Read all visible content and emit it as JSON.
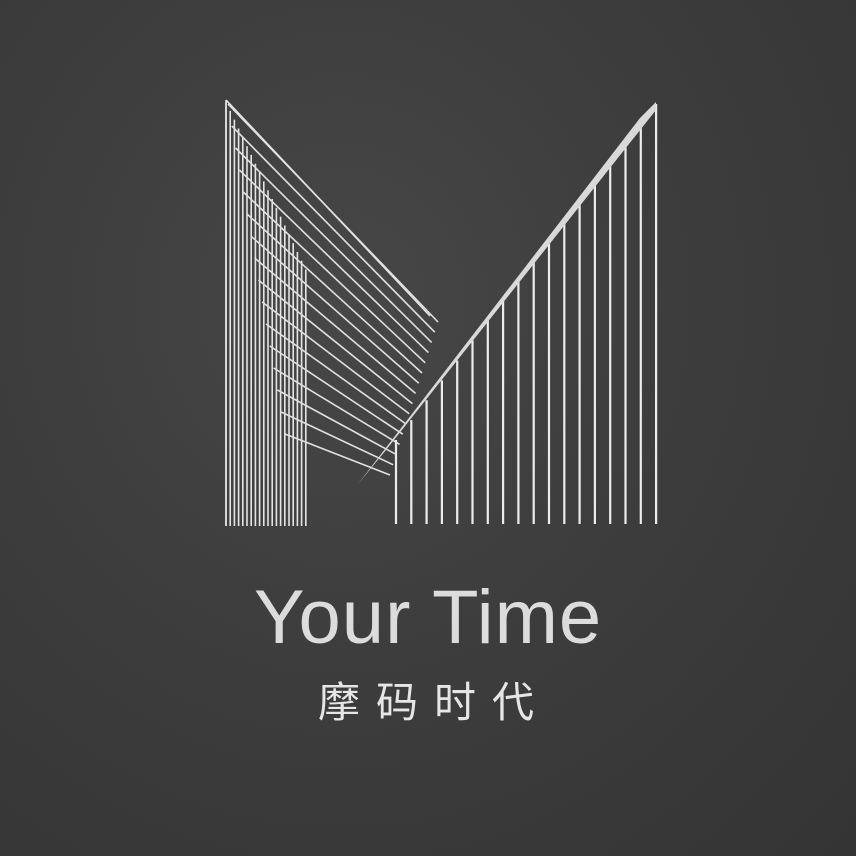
{
  "brand": {
    "name": "Your Time",
    "name_cn": "摩码时代"
  },
  "colors": {
    "background": "#3d3d3d",
    "mark_stroke": "#e6e6e6",
    "text": "#dcdcdc"
  },
  "icons": {
    "logo": "m-lines-logo-icon"
  }
}
